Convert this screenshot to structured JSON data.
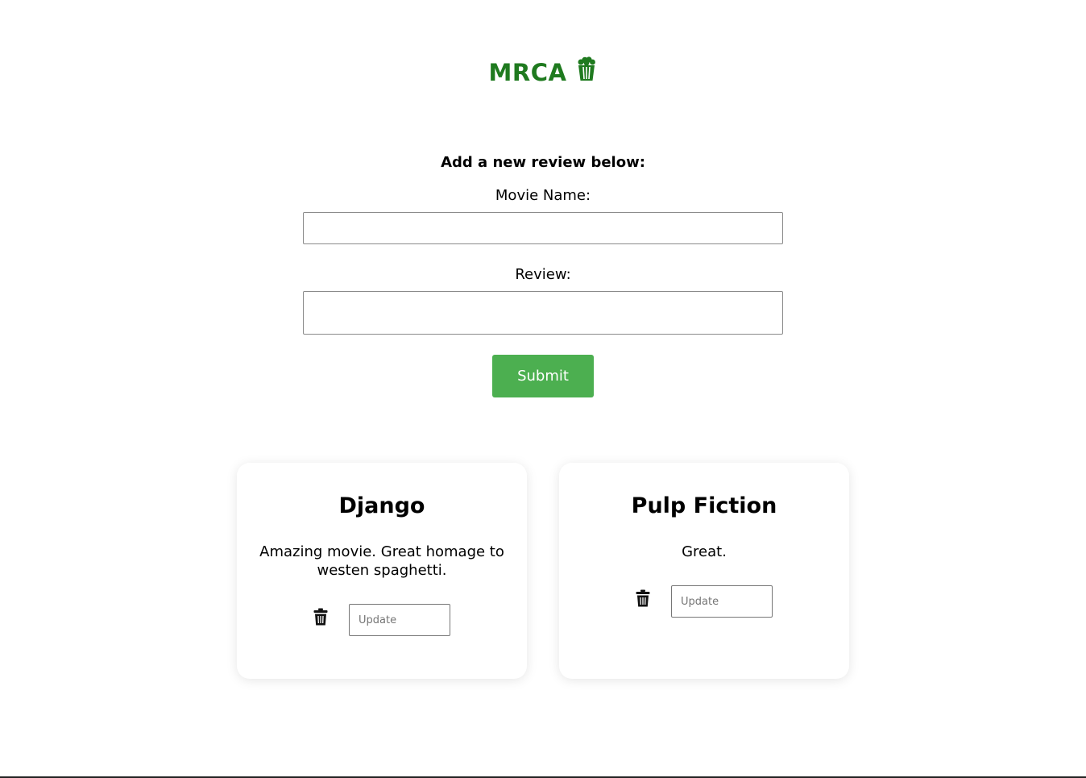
{
  "header": {
    "brand": "MRCA",
    "brand_icon": "popcorn-icon",
    "brand_color": "#1f7a1f"
  },
  "form": {
    "heading": "Add a new review below:",
    "movie_name_label": "Movie Name:",
    "movie_name_value": "",
    "review_label": "Review:",
    "review_value": "",
    "submit_label": "Submit",
    "submit_color": "#4caf50"
  },
  "reviews": [
    {
      "title": "Django",
      "review": "Amazing movie. Great homage to westen spaghetti.",
      "delete_icon": "trash-icon",
      "update_placeholder": "Update"
    },
    {
      "title": "Pulp Fiction",
      "review": "Great.",
      "delete_icon": "trash-icon",
      "update_placeholder": "Update"
    }
  ]
}
